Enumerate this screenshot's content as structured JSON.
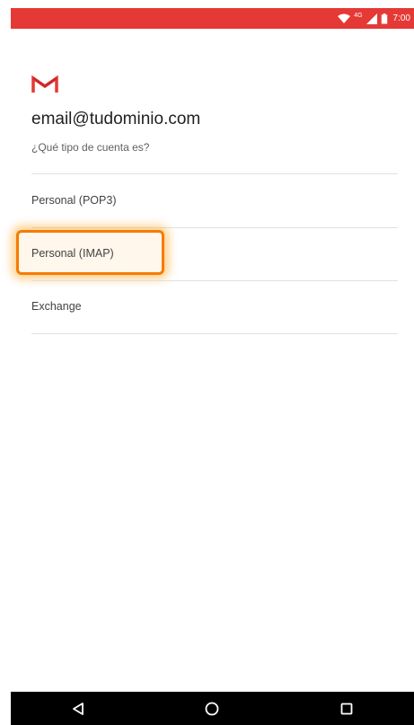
{
  "status_bar": {
    "time": "7:00",
    "network_label": "4G",
    "bg_color": "#e53935",
    "icons": [
      "wifi-icon",
      "signal-icon",
      "battery-icon"
    ]
  },
  "app": {
    "logo_icon": "gmail-logo-icon",
    "email": "email@tudominio.com",
    "question": "¿Qué tipo de cuenta es?"
  },
  "account_types": [
    {
      "label": "Personal (POP3)",
      "highlighted": false
    },
    {
      "label": "Personal (IMAP)",
      "highlighted": true
    },
    {
      "label": "Exchange",
      "highlighted": false
    }
  ],
  "nav_bar": {
    "buttons": [
      "back-icon",
      "home-icon",
      "recents-icon"
    ]
  },
  "colors": {
    "accent": "#e53935",
    "highlight": "#f57c00"
  }
}
